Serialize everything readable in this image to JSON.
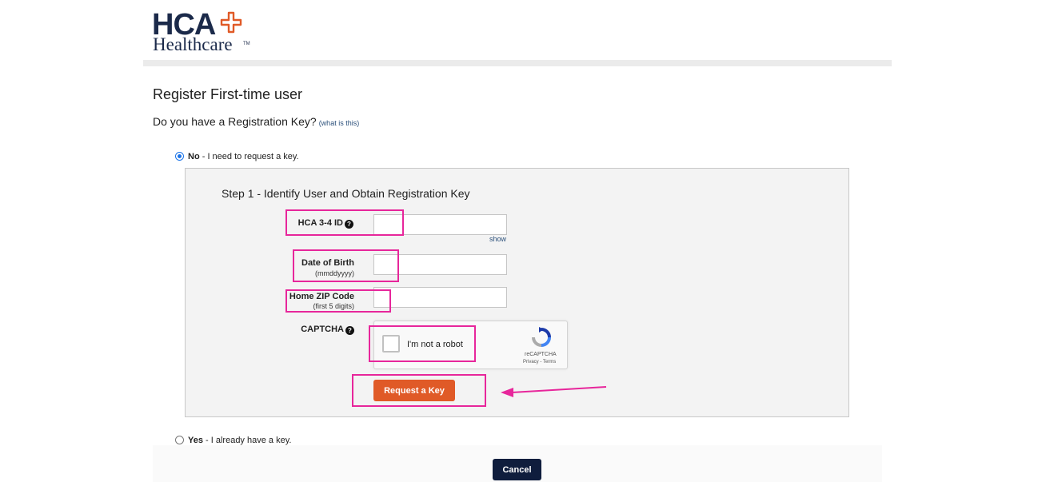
{
  "logo": {
    "hca": "HCA",
    "healthcare": "Healthcare",
    "tm": "TM"
  },
  "page": {
    "title": "Register First-time user",
    "question": "Do you have a Registration Key?",
    "what_is_this": "(what is this)"
  },
  "options": {
    "no": {
      "bold": "No",
      "text": " - I need to request a key.",
      "selected": true
    },
    "yes": {
      "bold": "Yes",
      "text": " - I already have a key.",
      "selected": false
    }
  },
  "step1": {
    "title": "Step 1 - Identify User and Obtain Registration Key",
    "hca_id_label": "HCA 3-4 ID",
    "show_link": "show",
    "dob_label": "Date of Birth",
    "dob_hint": "(mmddyyyy)",
    "zip_label": "Home ZIP Code",
    "zip_hint": "(first 5 digits)",
    "captcha_label": "CAPTCHA",
    "captcha_text": "I'm not a robot",
    "captcha_brand": "reCAPTCHA",
    "captcha_links": "Privacy - Terms",
    "request_button": "Request a Key"
  },
  "footer": {
    "cancel_button": "Cancel"
  },
  "colors": {
    "accent": "#e05a27",
    "navy": "#0f1d3d",
    "highlight": "#e7269b",
    "link": "#2a4f7a"
  }
}
